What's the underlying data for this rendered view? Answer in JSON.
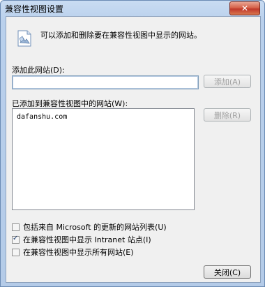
{
  "window": {
    "title": "兼容性视图设置"
  },
  "info": {
    "text": "可以添加和删除要在兼容性视图中显示的网站。"
  },
  "add_site": {
    "label": "添加此网站(D):",
    "value": "",
    "button": "添加(A)"
  },
  "site_list": {
    "label": "已添加到兼容性视图中的网站(W):",
    "items": [
      "dafanshu.com"
    ],
    "remove_button": "删除(R)"
  },
  "options": [
    {
      "label": "包括来自 Microsoft 的更新的网站列表(U)",
      "checked": false
    },
    {
      "label": "在兼容性视图中显示 Intranet 站点(I)",
      "checked": true
    },
    {
      "label": "在兼容性视图中显示所有网站(E)",
      "checked": false
    }
  ],
  "close_button": "关闭(C)",
  "colors": {
    "titlebar": "#b9d0ec",
    "close": "#c0392b",
    "client": "#f0f0f0"
  },
  "icons": {
    "info": "compatibility-view-icon",
    "close": "close-icon"
  }
}
